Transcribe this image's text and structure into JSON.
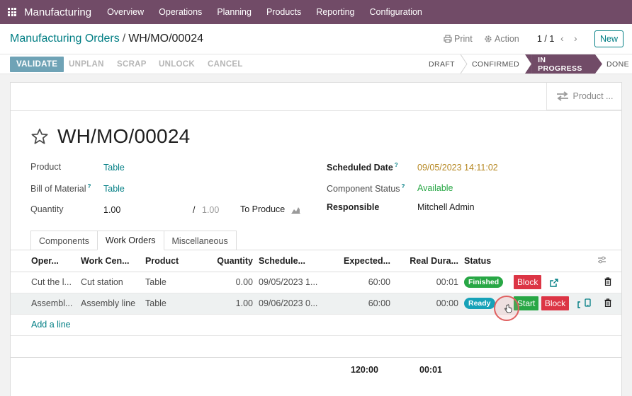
{
  "navbar": {
    "app_name": "Manufacturing",
    "menu": [
      "Overview",
      "Operations",
      "Planning",
      "Products",
      "Reporting",
      "Configuration"
    ]
  },
  "breadcrumb": {
    "parent": "Manufacturing Orders",
    "separator": "/",
    "current": "WH/MO/00024"
  },
  "toolbar": {
    "print": "Print",
    "action": "Action",
    "pager": "1 / 1",
    "new": "New"
  },
  "status_buttons": [
    "VALIDATE",
    "UNPLAN",
    "SCRAP",
    "UNLOCK",
    "CANCEL"
  ],
  "stages": [
    "DRAFT",
    "CONFIRMED",
    "IN PROGRESS",
    "DONE"
  ],
  "active_stage": "IN PROGRESS",
  "smart_button": {
    "label": "Product ..."
  },
  "record": {
    "title": "WH/MO/00024",
    "fields": {
      "product_label": "Product",
      "product": "Table",
      "bom_label": "Bill of Material",
      "bom": "Table",
      "quantity_label": "Quantity",
      "quantity": "1.00",
      "quantity_sep": "/",
      "quantity_max": "1.00",
      "to_produce": "To Produce",
      "scheduled_label": "Scheduled Date",
      "scheduled": "09/05/2023 14:11:02",
      "component_status_label": "Component Status",
      "component_status": "Available",
      "responsible_label": "Responsible",
      "responsible": "Mitchell Admin"
    }
  },
  "tabs": [
    "Components",
    "Work Orders",
    "Miscellaneous"
  ],
  "active_tab": "Work Orders",
  "work_orders": {
    "columns": [
      "Oper...",
      "Work Cen...",
      "Product",
      "Quantity",
      "Schedule...",
      "Expected...",
      "Real Dura...",
      "Status"
    ],
    "rows": [
      {
        "operation": "Cut the l...",
        "work_center": "Cut station",
        "product": "Table",
        "quantity": "0.00",
        "scheduled": "09/05/2023 1...",
        "expected": "60:00",
        "real": "00:01",
        "status": "Finished",
        "buttons": [
          "Block"
        ]
      },
      {
        "operation": "Assembl...",
        "work_center": "Assembly line",
        "product": "Table",
        "quantity": "1.00",
        "scheduled": "09/06/2023 0...",
        "expected": "60:00",
        "real": "00:00",
        "status": "Ready",
        "buttons": [
          "Start",
          "Block"
        ]
      }
    ],
    "add_line": "Add a line",
    "totals": {
      "expected": "120:00",
      "real": "00:01"
    }
  },
  "colors": {
    "brand": "#714b67",
    "link": "#017e84",
    "validate": "#6fa3b6",
    "finished": "#28a745",
    "ready": "#17a2b8",
    "block": "#dc3545"
  }
}
